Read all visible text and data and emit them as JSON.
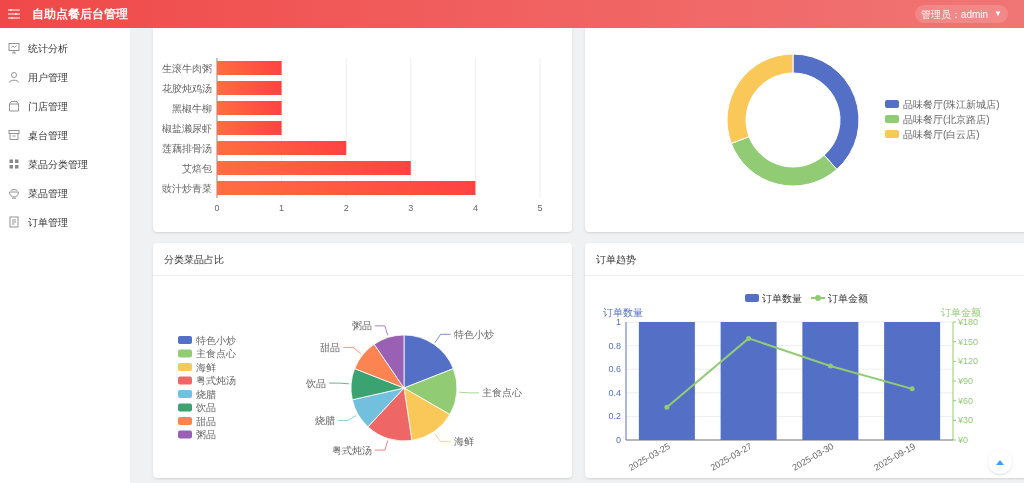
{
  "header": {
    "title": "自助点餐后台管理",
    "user": "管理员：admin",
    "caret": "▼"
  },
  "sidebar": {
    "items": [
      {
        "label": "统计分析"
      },
      {
        "label": "用户管理"
      },
      {
        "label": "门店管理"
      },
      {
        "label": "桌台管理"
      },
      {
        "label": "菜品分类管理"
      },
      {
        "label": "菜品管理"
      },
      {
        "label": "订单管理"
      }
    ]
  },
  "dish_sales": {
    "chart_data": {
      "type": "bar",
      "orientation": "horizontal",
      "grid": true,
      "categories": [
        "生滚牛肉粥",
        "花胶炖鸡汤",
        "黑椒牛柳",
        "椒盐濑尿虾",
        "莲藕排骨汤",
        "艾焙包",
        "豉汁炒青菜"
      ],
      "values": [
        1,
        1,
        1,
        1,
        2,
        3,
        4
      ],
      "xlim": [
        0,
        5
      ],
      "xticks": [
        0,
        1,
        2,
        3,
        4,
        5
      ]
    }
  },
  "store_share": {
    "chart_data": {
      "type": "donut",
      "legend": true,
      "categories": [
        "品味餐厅(珠江新城店)",
        "品味餐厅(北京路店)",
        "品味餐厅(白云店)"
      ],
      "values": [
        38.46,
        30.77,
        30.77
      ]
    }
  },
  "category_share": {
    "title": "分类菜品占比",
    "chart_data": {
      "type": "pie",
      "legend": true,
      "categories": [
        "特色小炒",
        "主食点心",
        "海鲜",
        "粤式炖汤",
        "烧腊",
        "饮品",
        "甜品",
        "粥品"
      ],
      "values": [
        19.05,
        14.29,
        14.29,
        14.29,
        9.52,
        9.52,
        9.52,
        9.52
      ]
    }
  },
  "order_trend": {
    "title": "订单趋势",
    "chart_data": {
      "type": "bar",
      "grid": true,
      "legend": true,
      "categories": [
        "2025-03-25",
        "2025-03-27",
        "2025-03-30",
        "2025-09-19"
      ],
      "ylabel": "订单数量",
      "y2label": "订单金额",
      "ylim": [
        0,
        1
      ],
      "y2lim": [
        0,
        180
      ],
      "yticks": [
        0,
        0.2,
        0.4,
        0.6,
        0.8,
        1
      ],
      "y2ticks": [
        {
          "value": 0,
          "label": "¥0"
        },
        {
          "value": 30,
          "label": "¥30"
        },
        {
          "value": 60,
          "label": "¥60"
        },
        {
          "value": 90,
          "label": "¥90"
        },
        {
          "value": 120,
          "label": "¥120"
        },
        {
          "value": 150,
          "label": "¥150"
        },
        {
          "value": 180,
          "label": "¥180"
        }
      ],
      "series": [
        {
          "name": "订单数量",
          "type": "bar",
          "color": "#5470c6",
          "values": [
            1,
            1,
            1,
            1
          ]
        },
        {
          "name": "订单金额",
          "type": "line",
          "axis": "y2",
          "color": "#91cc75",
          "values": [
            50,
            155,
            113,
            78
          ]
        }
      ]
    }
  }
}
